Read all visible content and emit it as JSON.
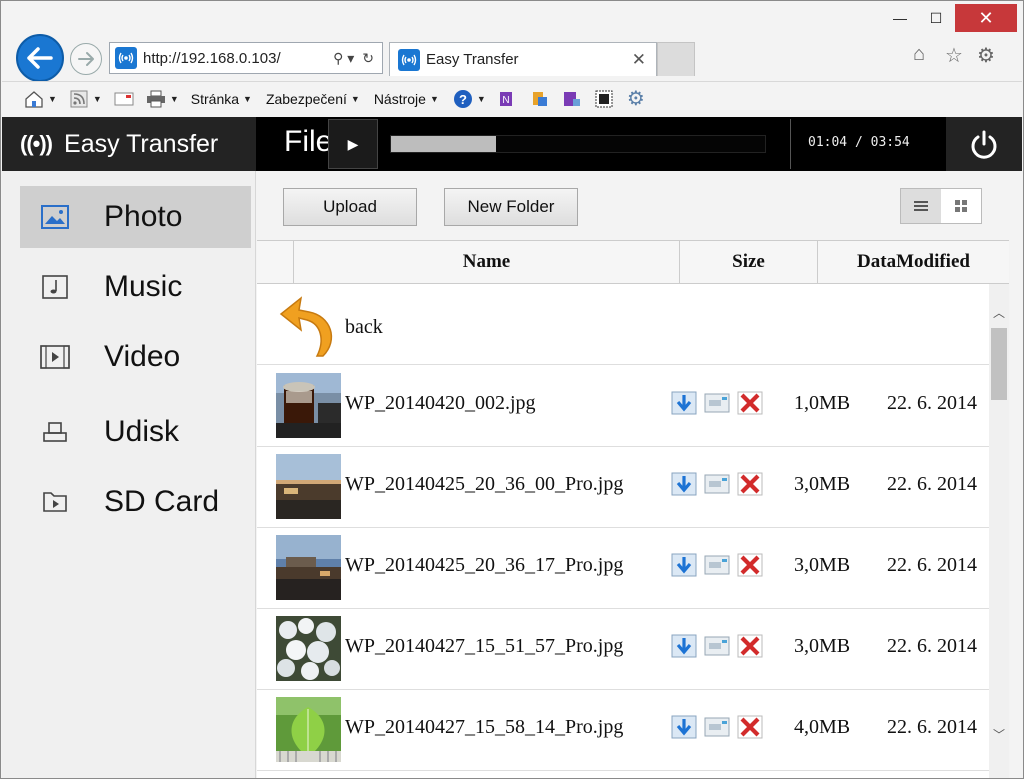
{
  "browser": {
    "url": "http://192.168.0.103/",
    "tab_title": "Easy Transfer",
    "window_controls": {
      "minimize": "—",
      "maximize": "☐",
      "close": "✕"
    },
    "command_bar": {
      "menus": [
        "Stránka",
        "Zabezpečení",
        "Nástroje"
      ]
    }
  },
  "app": {
    "brand": "Easy Transfer",
    "player": {
      "title": "File",
      "time": "01:04 / 03:54",
      "progress_fraction": 0.28
    }
  },
  "sidebar": {
    "items": [
      {
        "label": "Photo",
        "icon": "photo-icon",
        "active": true
      },
      {
        "label": "Music",
        "icon": "music-icon",
        "active": false
      },
      {
        "label": "Video",
        "icon": "video-icon",
        "active": false
      },
      {
        "label": "Udisk",
        "icon": "udisk-icon",
        "active": false
      },
      {
        "label": "SD Card",
        "icon": "sd-card-icon",
        "active": false
      }
    ]
  },
  "toolbar": {
    "upload_label": "Upload",
    "new_folder_label": "New Folder"
  },
  "table": {
    "columns": [
      "Name",
      "Size",
      "DataModified"
    ],
    "back_label": "back",
    "rows": [
      {
        "name": "WP_20140420_002.jpg",
        "size": "1,0MB",
        "date": "22. 6. 2014"
      },
      {
        "name": "WP_20140425_20_36_00_Pro.jpg",
        "size": "3,0MB",
        "date": "22. 6. 2014"
      },
      {
        "name": "WP_20140425_20_36_17_Pro.jpg",
        "size": "3,0MB",
        "date": "22. 6. 2014"
      },
      {
        "name": "WP_20140427_15_51_57_Pro.jpg",
        "size": "3,0MB",
        "date": "22. 6. 2014"
      },
      {
        "name": "WP_20140427_15_58_14_Pro.jpg",
        "size": "4,0MB",
        "date": "22. 6. 2014"
      }
    ]
  },
  "colors": {
    "browser_accent": "#1a77d2",
    "header_bg": "#232323",
    "close_button": "#c7383a",
    "sidebar_active": "#cfcfcf"
  }
}
